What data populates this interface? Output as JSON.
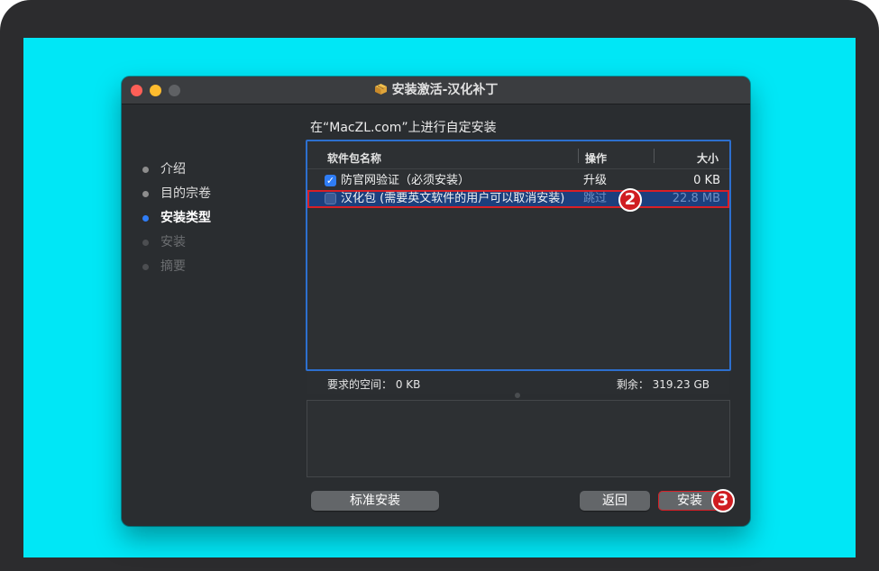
{
  "window": {
    "title": "安装激活-汉化补丁",
    "icon": "package-icon"
  },
  "sidebar": {
    "steps": [
      {
        "label": "介绍",
        "state": "done"
      },
      {
        "label": "目的宗卷",
        "state": "done"
      },
      {
        "label": "安装类型",
        "state": "active"
      },
      {
        "label": "安装",
        "state": "future"
      },
      {
        "label": "摘要",
        "state": "future"
      }
    ]
  },
  "main": {
    "heading": "在“MacZL.com”上进行自定安装",
    "table": {
      "columns": {
        "name": "软件包名称",
        "action": "操作",
        "size": "大小"
      },
      "rows": [
        {
          "checked": true,
          "name": "防官网验证（必须安装）",
          "action": "升级",
          "size": "0 KB"
        },
        {
          "checked": false,
          "name": "汉化包 (需要英文软件的用户可以取消安装)",
          "action": "跳过",
          "size": "22.8 MB"
        }
      ]
    },
    "space": {
      "required": "要求的空间：  0 KB",
      "remaining": "剩余：  319.23 GB"
    }
  },
  "buttons": {
    "custom_install": "标准安装",
    "back": "返回",
    "install": "安装"
  },
  "annotations": {
    "badge_row": "2",
    "badge_install": "3"
  },
  "colors": {
    "screen_background": "#00e7f6",
    "window_background": "#2a2d30",
    "accent_blue": "#2f7df6",
    "annotation_red": "#d01d21"
  }
}
